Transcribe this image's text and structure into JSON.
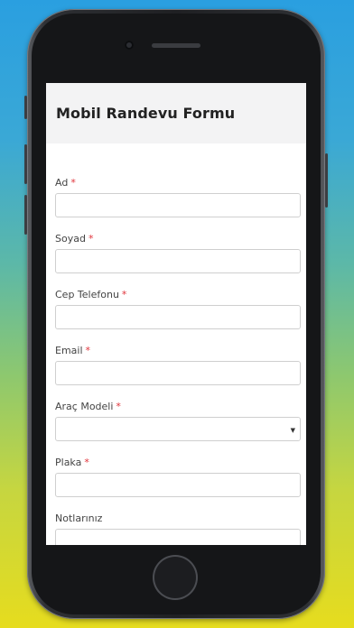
{
  "form": {
    "title": "Mobil Randevu Formu",
    "required_marker": "*",
    "fields": [
      {
        "label": "Ad",
        "required": true,
        "type": "text",
        "value": ""
      },
      {
        "label": "Soyad",
        "required": true,
        "type": "text",
        "value": ""
      },
      {
        "label": "Cep Telefonu",
        "required": true,
        "type": "tel",
        "value": ""
      },
      {
        "label": "Email",
        "required": true,
        "type": "email",
        "value": ""
      },
      {
        "label": "Araç Modeli",
        "required": true,
        "type": "select",
        "selected": ""
      },
      {
        "label": "Plaka",
        "required": true,
        "type": "text",
        "value": ""
      },
      {
        "label": "Notlarınız",
        "required": false,
        "type": "textarea",
        "value": ""
      }
    ]
  },
  "icons": {
    "select_arrow": "chevron-down-icon"
  },
  "colors": {
    "background_top": "#2a9fe0",
    "background_bottom": "#e6dc1e",
    "phone_body": "#1f2023",
    "header_bg": "#f3f3f4",
    "required_marker": "#e0333a",
    "input_border": "#cfcfcf"
  }
}
